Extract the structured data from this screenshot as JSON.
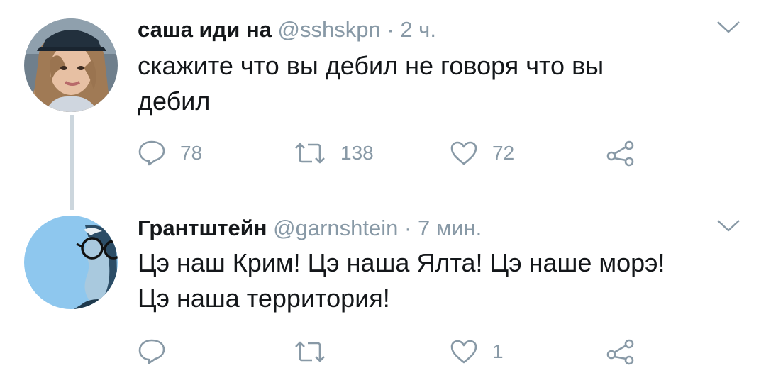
{
  "tweets": [
    {
      "name": "саша иди на",
      "handle": "@sshskpn",
      "separator": "·",
      "time": "2 ч.",
      "text_lines": [
        "скажите что вы дебил не говоря что вы",
        "дебил"
      ],
      "replies": "78",
      "retweets": "138",
      "likes": "72"
    },
    {
      "name": "Грантштейн",
      "handle": "@garnshtein",
      "separator": "·",
      "time": "7 мин.",
      "text_lines": [
        "Цэ наш Крим! Цэ наша Ялта! Цэ наше морэ!",
        "Цэ наша территория!"
      ],
      "replies": "",
      "retweets": "",
      "likes": "1"
    }
  ],
  "icons": {
    "reply": "reply-icon",
    "retweet": "retweet-icon",
    "like": "heart-icon",
    "share": "share-icon",
    "caret": "chevron-down-icon"
  },
  "colors": {
    "text": "#14171a",
    "secondary": "#8899a6",
    "thread_line": "#ccd6dd",
    "avatar2_bg": "#8ec7ee"
  }
}
